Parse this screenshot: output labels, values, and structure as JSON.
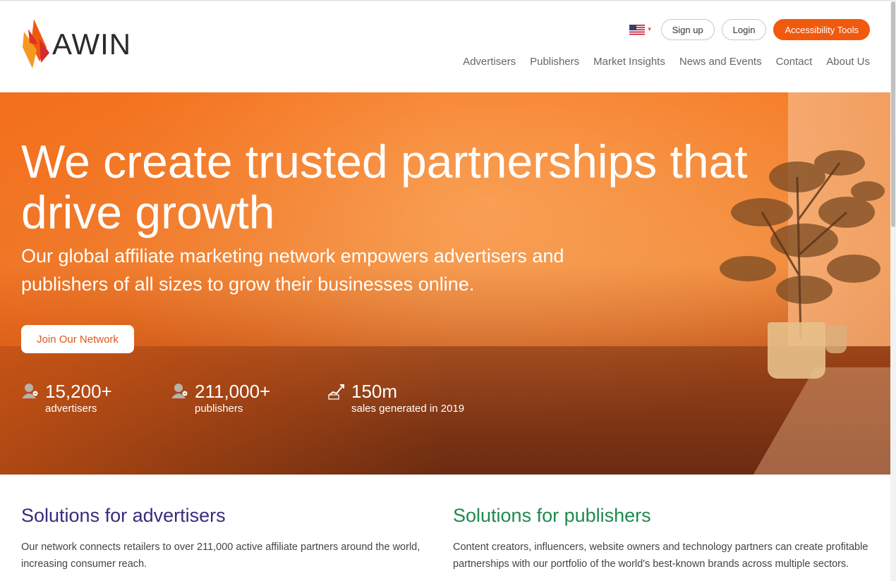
{
  "brand": {
    "name": "AWIN",
    "accent": "#f05a0e"
  },
  "top_actions": {
    "flag_icon": "us-flag-icon",
    "signup_label": "Sign up",
    "login_label": "Login",
    "accessibility_label": "Accessibility Tools"
  },
  "nav": {
    "items": [
      {
        "label": "Advertisers"
      },
      {
        "label": "Publishers"
      },
      {
        "label": "Market Insights"
      },
      {
        "label": "News and Events"
      },
      {
        "label": "Contact"
      },
      {
        "label": "About Us"
      }
    ]
  },
  "hero": {
    "title": "We create trusted partnerships that drive growth",
    "subtitle": "Our global affiliate marketing network empowers advertisers and publishers of all sizes to grow their businesses online.",
    "cta_label": "Join Our Network",
    "stats": [
      {
        "icon": "advertiser-icon",
        "value": "15,200+",
        "label": "advertisers"
      },
      {
        "icon": "publisher-icon",
        "value": "211,000+",
        "label": "publishers"
      },
      {
        "icon": "sales-chart-icon",
        "value": "150m",
        "label": "sales generated in 2019"
      }
    ]
  },
  "solutions": {
    "advertisers": {
      "title": "Solutions for advertisers",
      "text": "Our network connects retailers to over 211,000 active affiliate partners around the world, increasing consumer reach."
    },
    "publishers": {
      "title": "Solutions for publishers",
      "text": "Content creators, influencers, website owners and technology partners can create profitable partnerships with our portfolio of the world's best-known brands across multiple sectors."
    }
  }
}
